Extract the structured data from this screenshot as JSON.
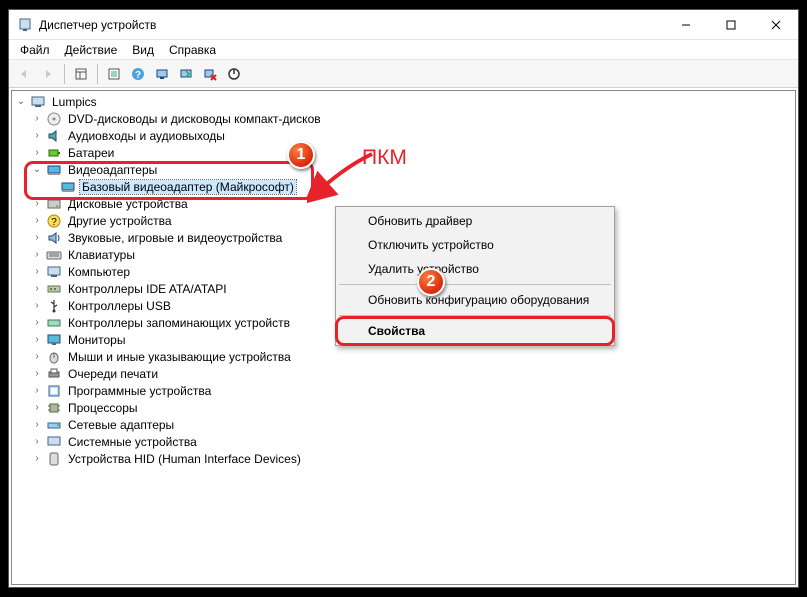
{
  "window": {
    "title": "Диспетчер устройств"
  },
  "menubar": {
    "file": "Файл",
    "action": "Действие",
    "view": "Вид",
    "help": "Справка"
  },
  "tree": {
    "root": "Lumpics",
    "items": {
      "dvd": "DVD-дисководы и дисководы компакт-дисков",
      "audio": "Аудиовходы и аудиовыходы",
      "battery": "Батареи",
      "video": "Видеоадаптеры",
      "video_child": "Базовый видеоадаптер (Майкрософт)",
      "disk": "Дисковые устройства",
      "other": "Другие устройства",
      "sound": "Звуковые, игровые и видеоустройства",
      "keyboard": "Клавиатуры",
      "computer": "Компьютер",
      "ide": "Контроллеры IDE ATA/ATAPI",
      "usb": "Контроллеры USB",
      "storage": "Контроллеры запоминающих устройств",
      "monitor": "Мониторы",
      "mouse": "Мыши и иные указывающие устройства",
      "print": "Очереди печати",
      "software": "Программные устройства",
      "cpu": "Процессоры",
      "network": "Сетевые адаптеры",
      "system": "Системные устройства",
      "hid": "Устройства HID (Human Interface Devices)"
    }
  },
  "context_menu": {
    "update": "Обновить драйвер",
    "disable": "Отключить устройство",
    "remove": "Удалить устройство",
    "scan": "Обновить конфигурацию оборудования",
    "properties": "Свойства"
  },
  "annotations": {
    "rmb": "ПКМ",
    "badge1": "1",
    "badge2": "2"
  }
}
